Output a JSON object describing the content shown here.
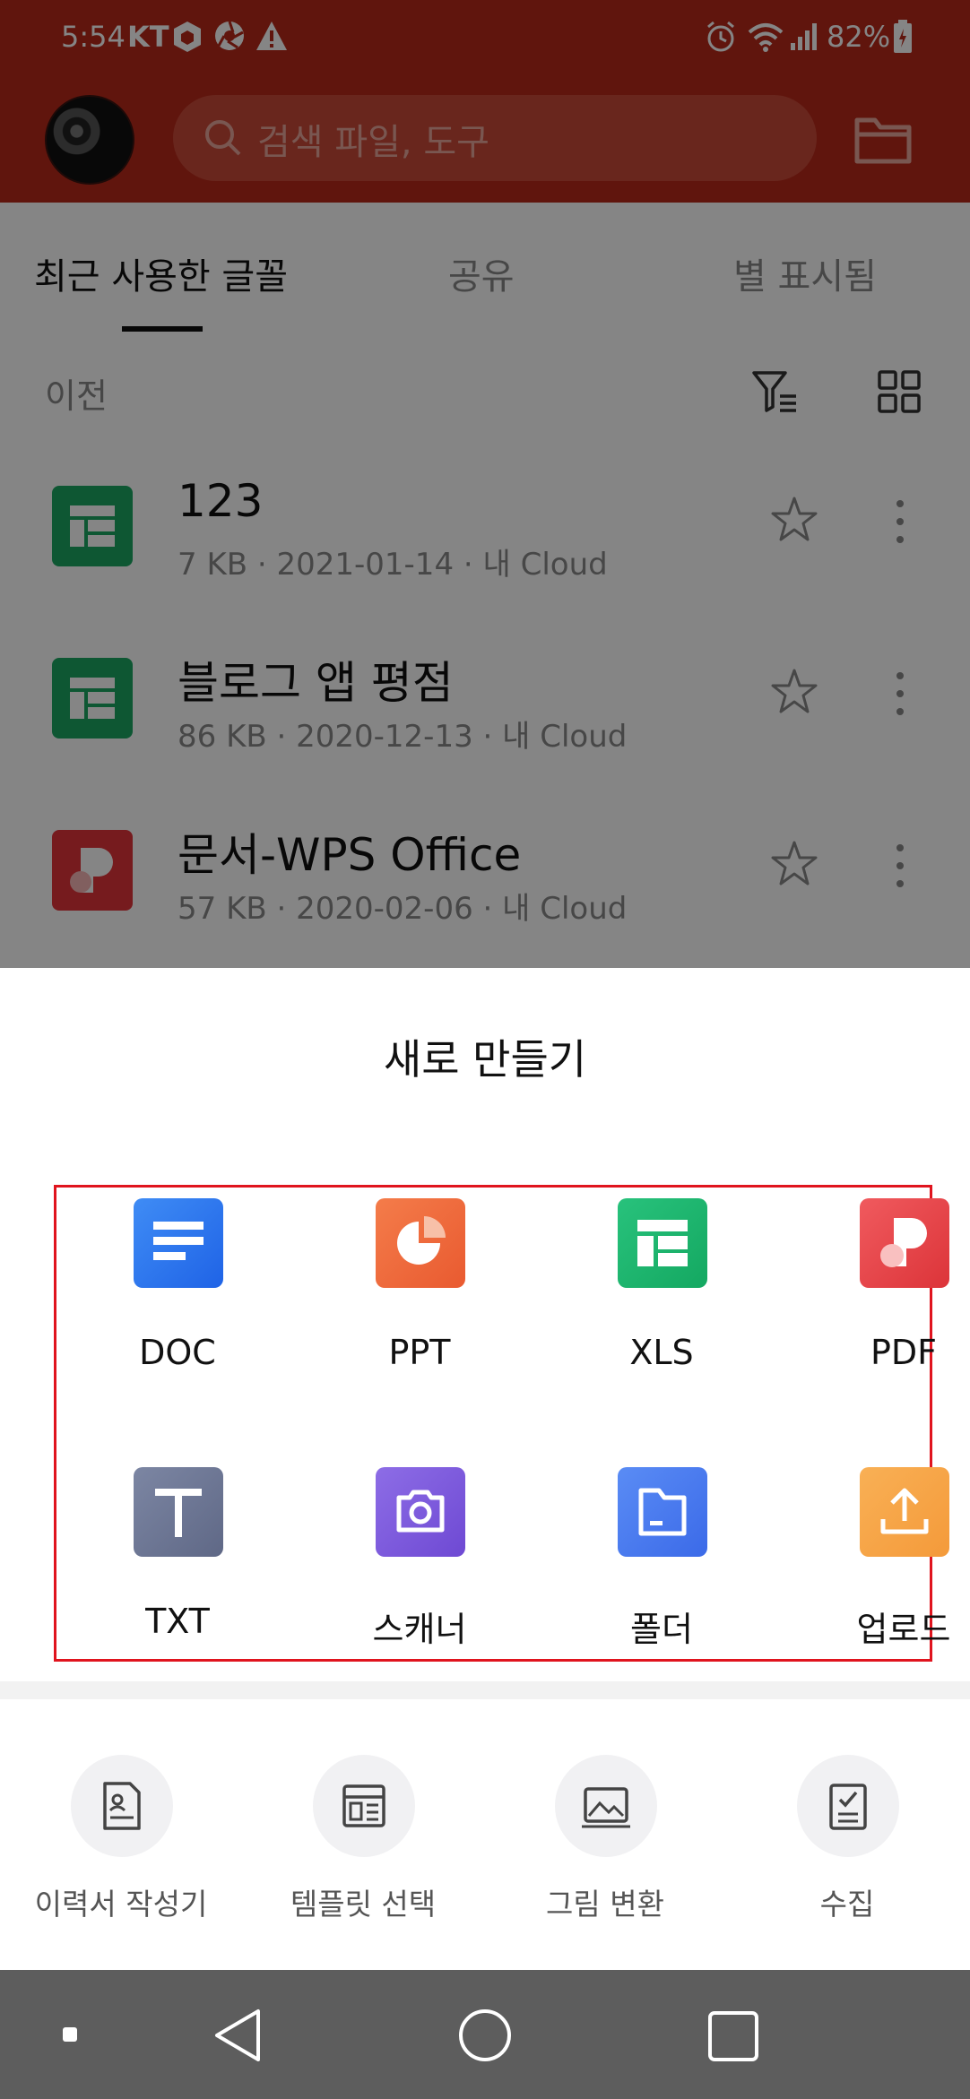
{
  "status": {
    "time": "5:54",
    "carrier": "KT",
    "battery": "82%"
  },
  "header": {
    "search_placeholder": "검색 파일, 도구"
  },
  "tabs": [
    "최근 사용한 글꼴",
    "공유",
    "별 표시됨"
  ],
  "section_label": "이전",
  "files": [
    {
      "name": "123",
      "meta": "7 KB · 2021-01-14 · 내 Cloud",
      "type": "xls"
    },
    {
      "name": "블로그 앱 평점",
      "meta": "86 KB · 2020-12-13 · 내 Cloud",
      "type": "xls"
    },
    {
      "name": "문서-WPS Office",
      "meta": "57 KB · 2020-02-06 · 내 Cloud",
      "type": "pdf"
    }
  ],
  "sheet": {
    "title": "새로 만들기",
    "create_items": [
      {
        "label": "DOC",
        "icon": "doc-icon",
        "color": "#2f7af0"
      },
      {
        "label": "PPT",
        "icon": "ppt-icon",
        "color": "#ef6a3c"
      },
      {
        "label": "XLS",
        "icon": "xls-icon",
        "color": "#1fb870"
      },
      {
        "label": "PDF",
        "icon": "pdf-icon",
        "color": "#e8474b"
      },
      {
        "label": "TXT",
        "icon": "txt-icon",
        "color": "#6b7493"
      },
      {
        "label": "스캐너",
        "icon": "camera-icon",
        "color": "#7e5bdc"
      },
      {
        "label": "폴더",
        "icon": "folder-icon",
        "color": "#4a7cf2"
      },
      {
        "label": "업로드",
        "icon": "upload-icon",
        "color": "#f7a343"
      }
    ],
    "tools": [
      {
        "label": "이력서 작성기",
        "icon": "resume-icon"
      },
      {
        "label": "템플릿 선택",
        "icon": "template-icon"
      },
      {
        "label": "그림 변환",
        "icon": "image-convert-icon"
      },
      {
        "label": "수집",
        "icon": "collect-icon"
      }
    ]
  }
}
